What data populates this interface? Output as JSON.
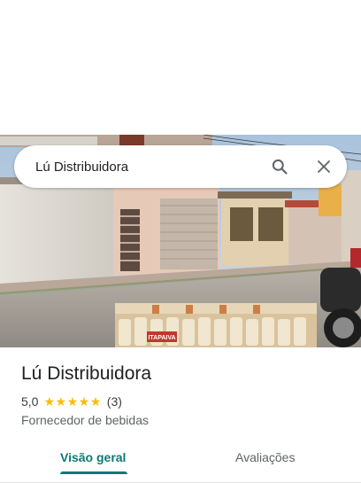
{
  "search": {
    "query": "Lú Distribuidora",
    "search_icon": "search-icon",
    "close_icon": "close-icon"
  },
  "place": {
    "title": "Lú Distribuidora",
    "rating": "5,0",
    "stars": 5,
    "review_count": "(3)",
    "category": "Fornecedor de bebidas"
  },
  "photo": {
    "sign_text": "ITAPAIVA"
  },
  "tabs": [
    {
      "label": "Visão geral",
      "active": true
    },
    {
      "label": "Avaliações",
      "active": false
    }
  ],
  "colors": {
    "accent": "#0b7a75",
    "star": "#fbbc04"
  }
}
